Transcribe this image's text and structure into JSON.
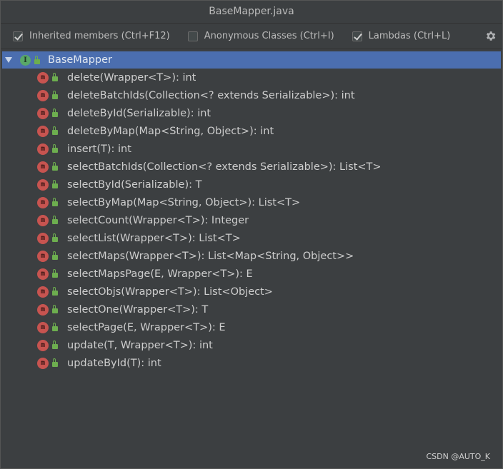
{
  "window": {
    "title": "BaseMapper.java"
  },
  "toolbar": {
    "options": [
      {
        "label": "Inherited members (Ctrl+F12)",
        "checked": true
      },
      {
        "label": "Anonymous Classes (Ctrl+I)",
        "checked": false
      },
      {
        "label": "Lambdas (Ctrl+L)",
        "checked": true
      }
    ],
    "settings_icon": "gear-icon"
  },
  "tree": {
    "root": {
      "label": "BaseMapper",
      "icon": "interface-icon",
      "icon_letter": "I",
      "expanded": true,
      "selected": true
    },
    "method_icon_letter": "m",
    "methods": [
      "delete(Wrapper<T>): int",
      "deleteBatchIds(Collection<? extends Serializable>): int",
      "deleteById(Serializable): int",
      "deleteByMap(Map<String, Object>): int",
      "insert(T): int",
      "selectBatchIds(Collection<? extends Serializable>): List<T>",
      "selectById(Serializable): T",
      "selectByMap(Map<String, Object>): List<T>",
      "selectCount(Wrapper<T>): Integer",
      "selectList(Wrapper<T>): List<T>",
      "selectMaps(Wrapper<T>): List<Map<String, Object>>",
      "selectMapsPage(E, Wrapper<T>): E",
      "selectObjs(Wrapper<T>): List<Object>",
      "selectOne(Wrapper<T>): T",
      "selectPage(E, Wrapper<T>): E",
      "update(T, Wrapper<T>): int",
      "updateById(T): int"
    ]
  },
  "watermark": "CSDN @AUTO_K",
  "colors": {
    "background": "#3c3f41",
    "selection": "#4b6eaf",
    "method_icon": "#c75450",
    "interface_icon": "#59a869",
    "lock": "#6dae4f"
  }
}
